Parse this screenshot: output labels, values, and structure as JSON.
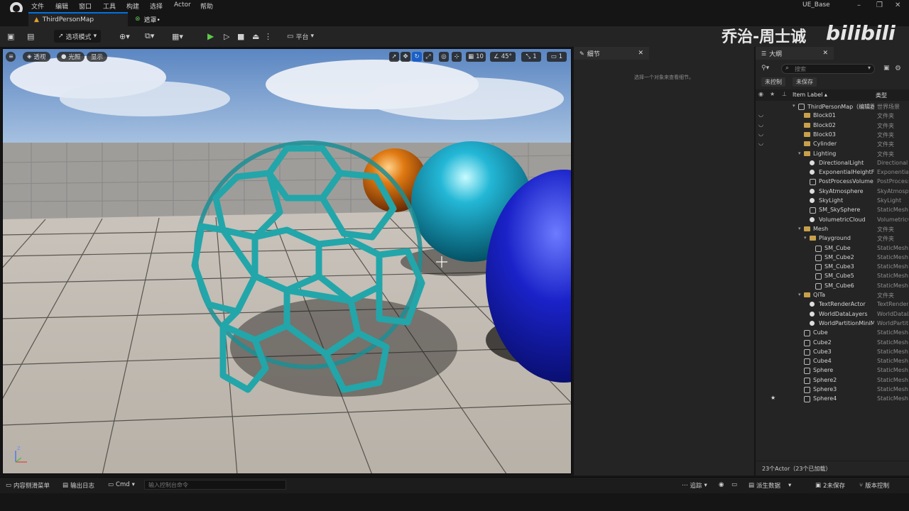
{
  "app": {
    "menu": [
      "文件",
      "编辑",
      "窗口",
      "工具",
      "构建",
      "选择",
      "Actor",
      "帮助"
    ],
    "project_name": "UE_Base",
    "window_controls": {
      "minimize": "–",
      "maximize": "❐",
      "close": "✕"
    }
  },
  "tabs": {
    "main": "ThirdPersonMap",
    "secondary": "遮罩•"
  },
  "toolbar": {
    "mode": "选项模式",
    "platform": "平台",
    "accent_play_color": "#5fc94a"
  },
  "viewport": {
    "menu_icon": "hamburger-icon",
    "perspective": "透视",
    "lighting": "光照",
    "show": "显示",
    "grid_snap": "10",
    "rotation_snap": "45°",
    "scale_snap": "1",
    "camera_speed": "1",
    "axis": {
      "z": "Z"
    }
  },
  "details": {
    "title": "细节",
    "empty_message": "选择一个对象来查看细节。"
  },
  "outliner": {
    "title": "大纲",
    "search_placeholder": "搜索",
    "filters": [
      "未控制",
      "未保存"
    ],
    "col_label": "Item Label ▴",
    "col_type": "类型",
    "rows": [
      {
        "label": "ThirdPersonMap（编辑器）",
        "type": "世界场景",
        "indent": 0,
        "icon": "map",
        "arrow": "▾"
      },
      {
        "label": "Block01",
        "type": "文件夹",
        "indent": 1,
        "icon": "folder"
      },
      {
        "label": "Block02",
        "type": "文件夹",
        "indent": 1,
        "icon": "folder"
      },
      {
        "label": "Block03",
        "type": "文件夹",
        "indent": 1,
        "icon": "folder"
      },
      {
        "label": "Cylinder",
        "type": "文件夹",
        "indent": 1,
        "icon": "folder"
      },
      {
        "label": "Lighting",
        "type": "文件夹",
        "indent": 1,
        "icon": "folder",
        "arrow": "▾"
      },
      {
        "label": "DirectionalLight",
        "type": "DirectionalLight",
        "indent": 2,
        "icon": "light"
      },
      {
        "label": "ExponentialHeightFog",
        "type": "ExponentialHeightFog",
        "indent": 2,
        "icon": "light"
      },
      {
        "label": "PostProcessVolume",
        "type": "PostProcessVolume",
        "indent": 2,
        "icon": "mesh"
      },
      {
        "label": "SkyAtmosphere",
        "type": "SkyAtmosphere",
        "indent": 2,
        "icon": "light"
      },
      {
        "label": "SkyLight",
        "type": "SkyLight",
        "indent": 2,
        "icon": "light"
      },
      {
        "label": "SM_SkySphere",
        "type": "StaticMeshActor",
        "indent": 2,
        "icon": "mesh"
      },
      {
        "label": "VolumetricCloud",
        "type": "VolumetricCloud",
        "indent": 2,
        "icon": "light"
      },
      {
        "label": "Mesh",
        "type": "文件夹",
        "indent": 1,
        "icon": "folder",
        "arrow": "▾"
      },
      {
        "label": "Playground",
        "type": "文件夹",
        "indent": 2,
        "icon": "folder",
        "arrow": "▾"
      },
      {
        "label": "SM_Cube",
        "type": "StaticMeshActor",
        "indent": 3,
        "icon": "mesh"
      },
      {
        "label": "SM_Cube2",
        "type": "StaticMeshActor",
        "indent": 3,
        "icon": "mesh"
      },
      {
        "label": "SM_Cube3",
        "type": "StaticMeshActor",
        "indent": 3,
        "icon": "mesh"
      },
      {
        "label": "SM_Cube5",
        "type": "StaticMeshActor",
        "indent": 3,
        "icon": "mesh"
      },
      {
        "label": "SM_Cube6",
        "type": "StaticMeshActor",
        "indent": 3,
        "icon": "mesh"
      },
      {
        "label": "QiTa",
        "type": "文件夹",
        "indent": 1,
        "icon": "folder",
        "arrow": "▾"
      },
      {
        "label": "TextRenderActor",
        "type": "TextRenderActor",
        "indent": 2,
        "icon": "text"
      },
      {
        "label": "WorldDataLayers",
        "type": "WorldDataLayers",
        "indent": 2,
        "icon": "light"
      },
      {
        "label": "WorldPartitionMiniMap",
        "type": "WorldPartitionMiniMap",
        "indent": 2,
        "icon": "light"
      },
      {
        "label": "Cube",
        "type": "StaticMeshActor",
        "indent": 1,
        "icon": "mesh"
      },
      {
        "label": "Cube2",
        "type": "StaticMeshActor",
        "indent": 1,
        "icon": "mesh"
      },
      {
        "label": "Cube3",
        "type": "StaticMeshActor",
        "indent": 1,
        "icon": "mesh"
      },
      {
        "label": "Cube4",
        "type": "StaticMeshActor",
        "indent": 1,
        "icon": "mesh"
      },
      {
        "label": "Sphere",
        "type": "StaticMeshActor",
        "indent": 1,
        "icon": "mesh"
      },
      {
        "label": "Sphere2",
        "type": "StaticMeshActor",
        "indent": 1,
        "icon": "mesh"
      },
      {
        "label": "Sphere3",
        "type": "StaticMeshActor",
        "indent": 1,
        "icon": "mesh"
      },
      {
        "label": "Sphere4",
        "type": "StaticMeshActor",
        "indent": 1,
        "icon": "mesh",
        "starred": true
      }
    ],
    "footer": "23个Actor（23个已加载）"
  },
  "statusbar": {
    "content_drawer": "内容侧滑菜单",
    "output_log": "输出日志",
    "cmd": "Cmd",
    "cmd_placeholder": "输入控制台命令",
    "trace": "追踪",
    "derived_data": "派生数据",
    "unsaved": "2未保存",
    "source_control": "版本控制"
  },
  "watermark": {
    "author": "乔治-周士诚",
    "site": "bilibili"
  }
}
